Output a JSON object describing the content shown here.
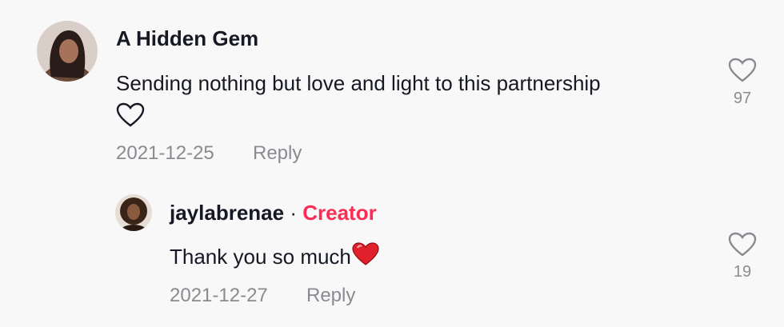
{
  "comment": {
    "author": "A Hidden Gem",
    "text": "Sending nothing but love and light to this partnership",
    "date": "2021-12-25",
    "reply_label": "Reply",
    "like_count": "97",
    "avatar_icon": "user-avatar-photo"
  },
  "reply": {
    "author": "jaylabrenae",
    "separator": "·",
    "badge": "Creator",
    "text": "Thank you so much",
    "date": "2021-12-27",
    "reply_label": "Reply",
    "like_count": "19",
    "avatar_icon": "creator-avatar-photo"
  },
  "colors": {
    "accent": "#fe2c55",
    "muted": "#8a8b91",
    "text": "#161823",
    "background": "#f8f8f8"
  }
}
